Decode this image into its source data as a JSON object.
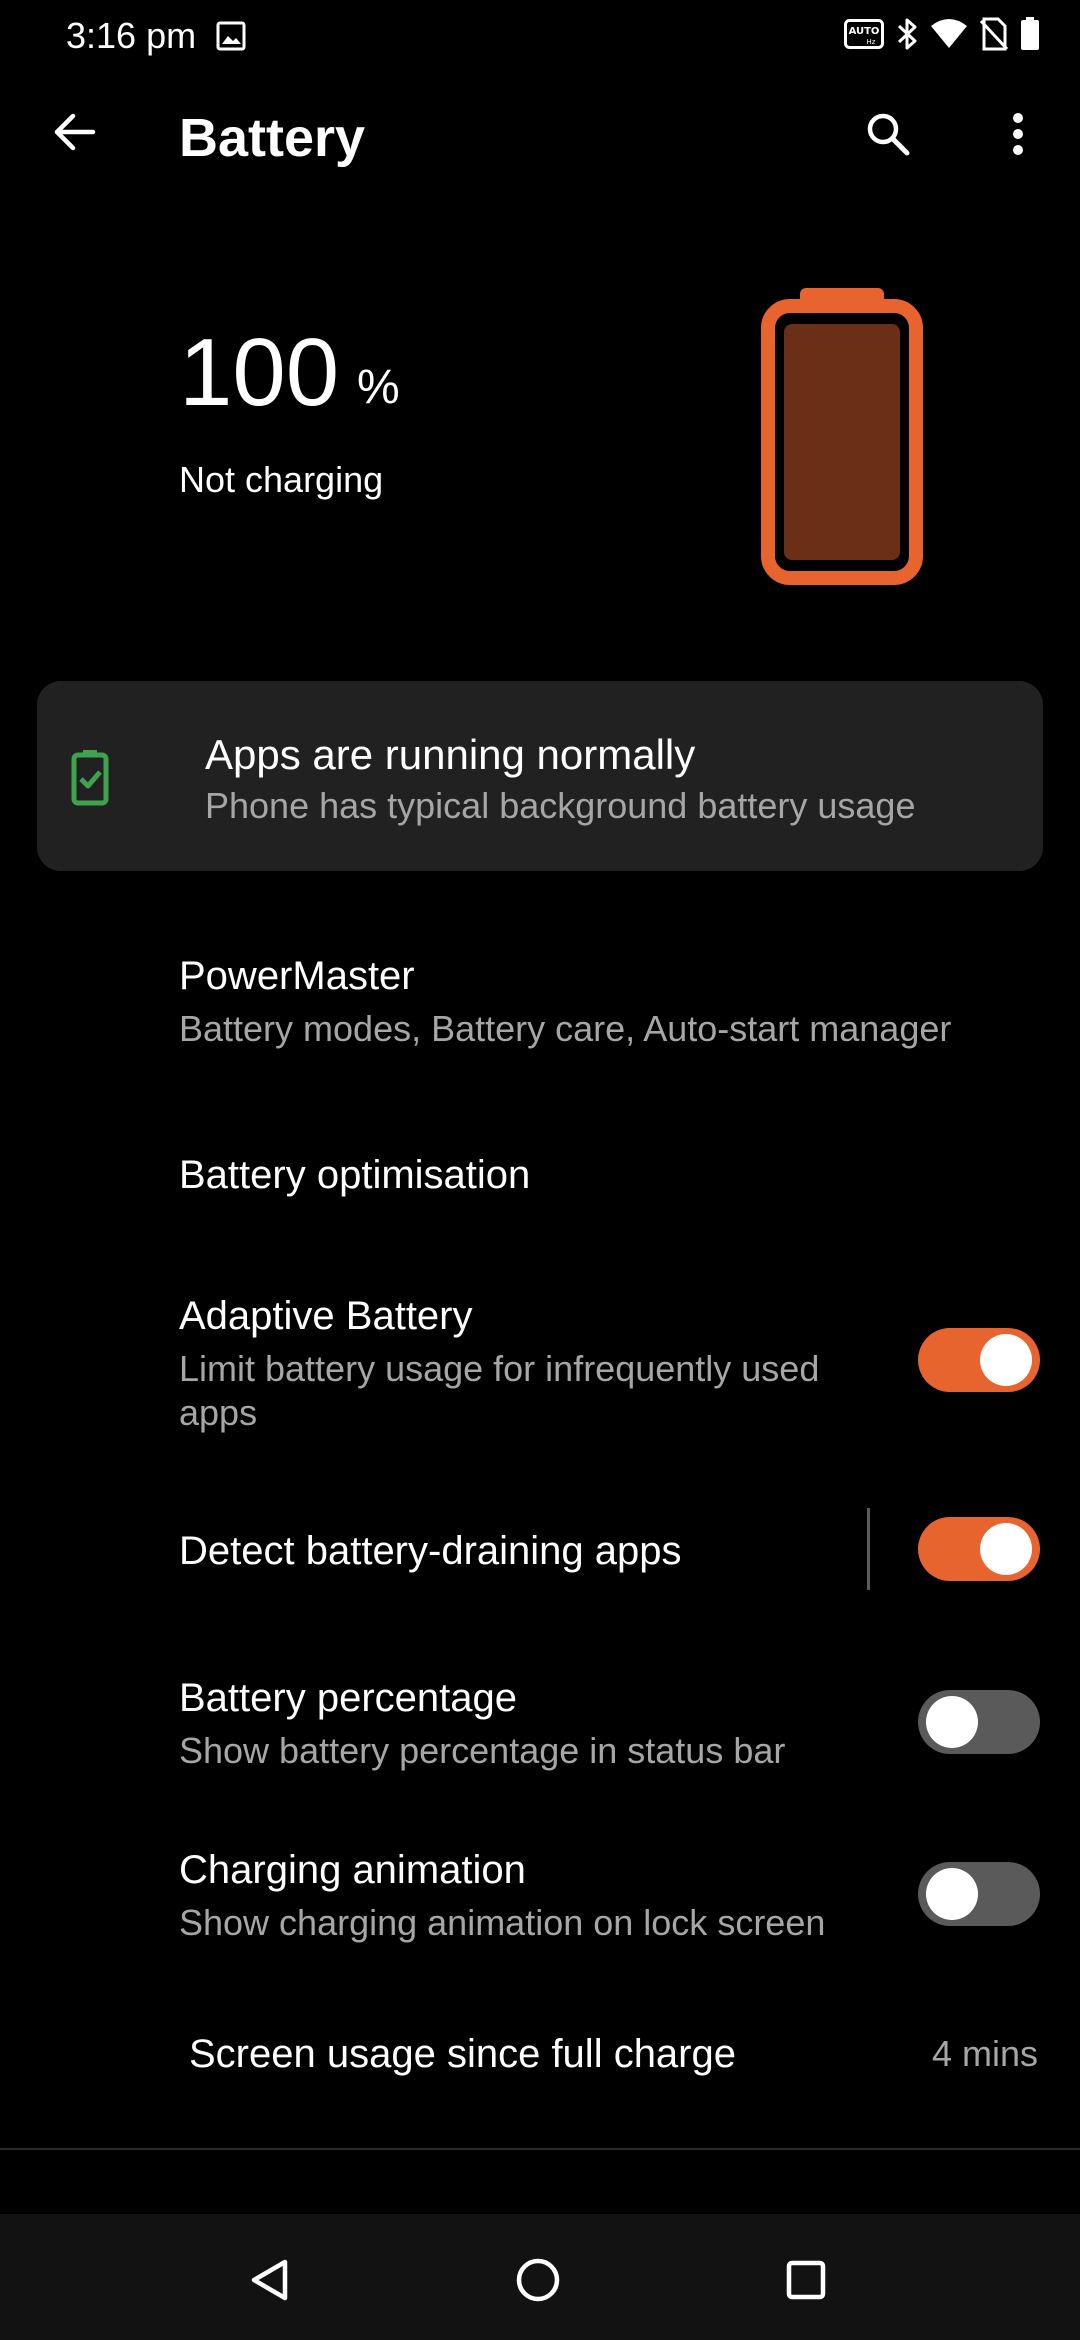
{
  "status_bar": {
    "time": "3:16 pm",
    "icons": [
      "gallery-icon",
      "auto-hz-icon",
      "bluetooth-icon",
      "wifi-icon",
      "no-sim-icon",
      "battery-full-icon"
    ]
  },
  "app_bar": {
    "title": "Battery",
    "back_icon": "arrow-back-icon",
    "search_icon": "search-icon",
    "more_icon": "more-vert-icon"
  },
  "battery_header": {
    "level": "100",
    "unit": "%",
    "status": "Not charging",
    "level_fraction": 1.0,
    "accent_color": "#e8642e",
    "fill_color": "#6b2e17"
  },
  "tip": {
    "title": "Apps are running normally",
    "summary": "Phone has typical background battery usage",
    "icon": "battery-check-icon",
    "icon_color": "#3fa34d"
  },
  "prefs": {
    "powermaster": {
      "title": "PowerMaster",
      "summary": "Battery modes, Battery care, Auto-start manager"
    },
    "optimisation": {
      "title": "Battery optimisation"
    },
    "adaptive": {
      "title": "Adaptive Battery",
      "summary_line1": "Limit battery usage for infrequently used",
      "summary_line2": "apps",
      "checked": true
    },
    "detect": {
      "title": "Detect battery-draining apps",
      "checked": true
    },
    "percentage": {
      "title": "Battery percentage",
      "summary": "Show battery percentage in status bar",
      "checked": false
    },
    "animation": {
      "title": "Charging animation",
      "summary": "Show charging animation on lock screen",
      "checked": false
    },
    "screen_usage": {
      "title": "Screen usage since full charge",
      "value": "4 mins"
    }
  },
  "nav_bar": {
    "back": "nav-back-icon",
    "home": "nav-home-icon",
    "recents": "nav-recents-icon"
  }
}
